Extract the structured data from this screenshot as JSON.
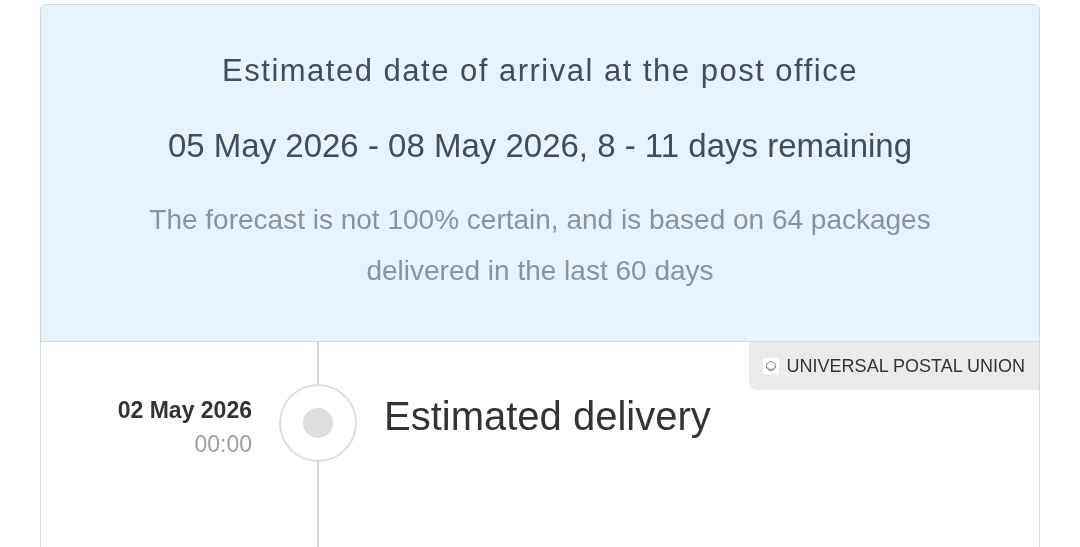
{
  "forecast": {
    "title": "Estimated date of arrival at the post office",
    "range": "05 May 2026 - 08 May 2026, 8 - 11 days remaining",
    "note": "The forecast is not 100% certain, and is based on 64 packages delivered in the last 60 days"
  },
  "events": [
    {
      "date": "02 May 2026",
      "time": "00:00",
      "title": "Estimated delivery",
      "source": "UNIVERSAL POSTAL UNION"
    }
  ]
}
